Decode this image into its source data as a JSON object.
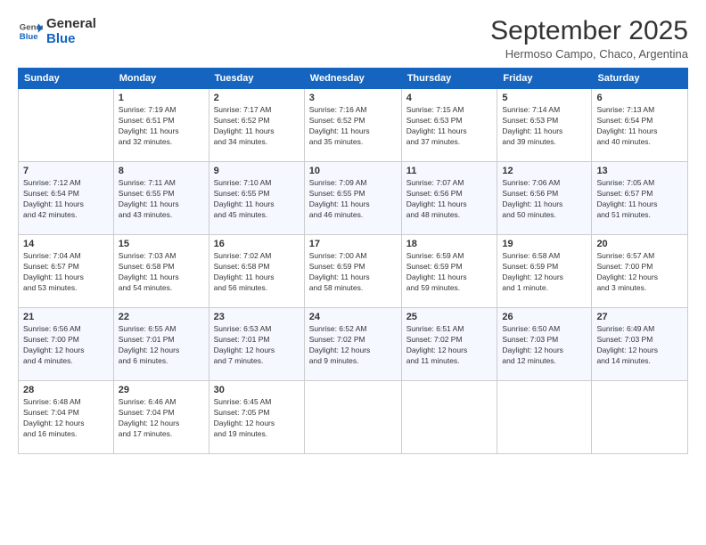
{
  "logo": {
    "general": "General",
    "blue": "Blue"
  },
  "header": {
    "title": "September 2025",
    "subtitle": "Hermoso Campo, Chaco, Argentina"
  },
  "days_of_week": [
    "Sunday",
    "Monday",
    "Tuesday",
    "Wednesday",
    "Thursday",
    "Friday",
    "Saturday"
  ],
  "weeks": [
    [
      {
        "day": "",
        "info": ""
      },
      {
        "day": "1",
        "info": "Sunrise: 7:19 AM\nSunset: 6:51 PM\nDaylight: 11 hours\nand 32 minutes."
      },
      {
        "day": "2",
        "info": "Sunrise: 7:17 AM\nSunset: 6:52 PM\nDaylight: 11 hours\nand 34 minutes."
      },
      {
        "day": "3",
        "info": "Sunrise: 7:16 AM\nSunset: 6:52 PM\nDaylight: 11 hours\nand 35 minutes."
      },
      {
        "day": "4",
        "info": "Sunrise: 7:15 AM\nSunset: 6:53 PM\nDaylight: 11 hours\nand 37 minutes."
      },
      {
        "day": "5",
        "info": "Sunrise: 7:14 AM\nSunset: 6:53 PM\nDaylight: 11 hours\nand 39 minutes."
      },
      {
        "day": "6",
        "info": "Sunrise: 7:13 AM\nSunset: 6:54 PM\nDaylight: 11 hours\nand 40 minutes."
      }
    ],
    [
      {
        "day": "7",
        "info": "Sunrise: 7:12 AM\nSunset: 6:54 PM\nDaylight: 11 hours\nand 42 minutes."
      },
      {
        "day": "8",
        "info": "Sunrise: 7:11 AM\nSunset: 6:55 PM\nDaylight: 11 hours\nand 43 minutes."
      },
      {
        "day": "9",
        "info": "Sunrise: 7:10 AM\nSunset: 6:55 PM\nDaylight: 11 hours\nand 45 minutes."
      },
      {
        "day": "10",
        "info": "Sunrise: 7:09 AM\nSunset: 6:55 PM\nDaylight: 11 hours\nand 46 minutes."
      },
      {
        "day": "11",
        "info": "Sunrise: 7:07 AM\nSunset: 6:56 PM\nDaylight: 11 hours\nand 48 minutes."
      },
      {
        "day": "12",
        "info": "Sunrise: 7:06 AM\nSunset: 6:56 PM\nDaylight: 11 hours\nand 50 minutes."
      },
      {
        "day": "13",
        "info": "Sunrise: 7:05 AM\nSunset: 6:57 PM\nDaylight: 11 hours\nand 51 minutes."
      }
    ],
    [
      {
        "day": "14",
        "info": "Sunrise: 7:04 AM\nSunset: 6:57 PM\nDaylight: 11 hours\nand 53 minutes."
      },
      {
        "day": "15",
        "info": "Sunrise: 7:03 AM\nSunset: 6:58 PM\nDaylight: 11 hours\nand 54 minutes."
      },
      {
        "day": "16",
        "info": "Sunrise: 7:02 AM\nSunset: 6:58 PM\nDaylight: 11 hours\nand 56 minutes."
      },
      {
        "day": "17",
        "info": "Sunrise: 7:00 AM\nSunset: 6:59 PM\nDaylight: 11 hours\nand 58 minutes."
      },
      {
        "day": "18",
        "info": "Sunrise: 6:59 AM\nSunset: 6:59 PM\nDaylight: 11 hours\nand 59 minutes."
      },
      {
        "day": "19",
        "info": "Sunrise: 6:58 AM\nSunset: 6:59 PM\nDaylight: 12 hours\nand 1 minute."
      },
      {
        "day": "20",
        "info": "Sunrise: 6:57 AM\nSunset: 7:00 PM\nDaylight: 12 hours\nand 3 minutes."
      }
    ],
    [
      {
        "day": "21",
        "info": "Sunrise: 6:56 AM\nSunset: 7:00 PM\nDaylight: 12 hours\nand 4 minutes."
      },
      {
        "day": "22",
        "info": "Sunrise: 6:55 AM\nSunset: 7:01 PM\nDaylight: 12 hours\nand 6 minutes."
      },
      {
        "day": "23",
        "info": "Sunrise: 6:53 AM\nSunset: 7:01 PM\nDaylight: 12 hours\nand 7 minutes."
      },
      {
        "day": "24",
        "info": "Sunrise: 6:52 AM\nSunset: 7:02 PM\nDaylight: 12 hours\nand 9 minutes."
      },
      {
        "day": "25",
        "info": "Sunrise: 6:51 AM\nSunset: 7:02 PM\nDaylight: 12 hours\nand 11 minutes."
      },
      {
        "day": "26",
        "info": "Sunrise: 6:50 AM\nSunset: 7:03 PM\nDaylight: 12 hours\nand 12 minutes."
      },
      {
        "day": "27",
        "info": "Sunrise: 6:49 AM\nSunset: 7:03 PM\nDaylight: 12 hours\nand 14 minutes."
      }
    ],
    [
      {
        "day": "28",
        "info": "Sunrise: 6:48 AM\nSunset: 7:04 PM\nDaylight: 12 hours\nand 16 minutes."
      },
      {
        "day": "29",
        "info": "Sunrise: 6:46 AM\nSunset: 7:04 PM\nDaylight: 12 hours\nand 17 minutes."
      },
      {
        "day": "30",
        "info": "Sunrise: 6:45 AM\nSunset: 7:05 PM\nDaylight: 12 hours\nand 19 minutes."
      },
      {
        "day": "",
        "info": ""
      },
      {
        "day": "",
        "info": ""
      },
      {
        "day": "",
        "info": ""
      },
      {
        "day": "",
        "info": ""
      }
    ]
  ]
}
